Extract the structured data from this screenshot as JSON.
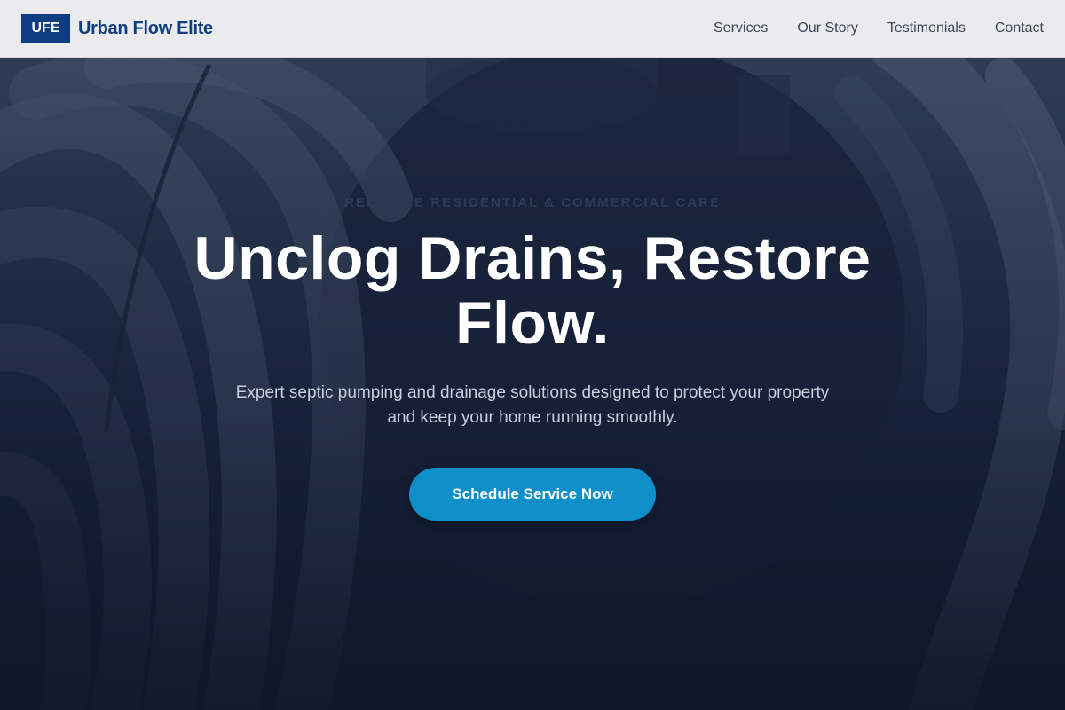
{
  "brand": {
    "logo_text": "UFE",
    "name": "Urban Flow Elite"
  },
  "nav": {
    "items": [
      {
        "label": "Services"
      },
      {
        "label": "Our Story"
      },
      {
        "label": "Testimonials"
      },
      {
        "label": "Contact"
      }
    ]
  },
  "hero": {
    "eyebrow": "Reliable Residential & Commercial Care",
    "headline": "Unclog Drains, Restore Flow.",
    "subhead": "Expert septic pumping and drainage solutions designed to protect your property and keep your home running smoothly.",
    "cta_label": "Schedule Service Now"
  },
  "colors": {
    "brand_blue": "#0e3d82",
    "cta_blue": "#0e8fc9",
    "hero_dark": "#0f1a30"
  }
}
